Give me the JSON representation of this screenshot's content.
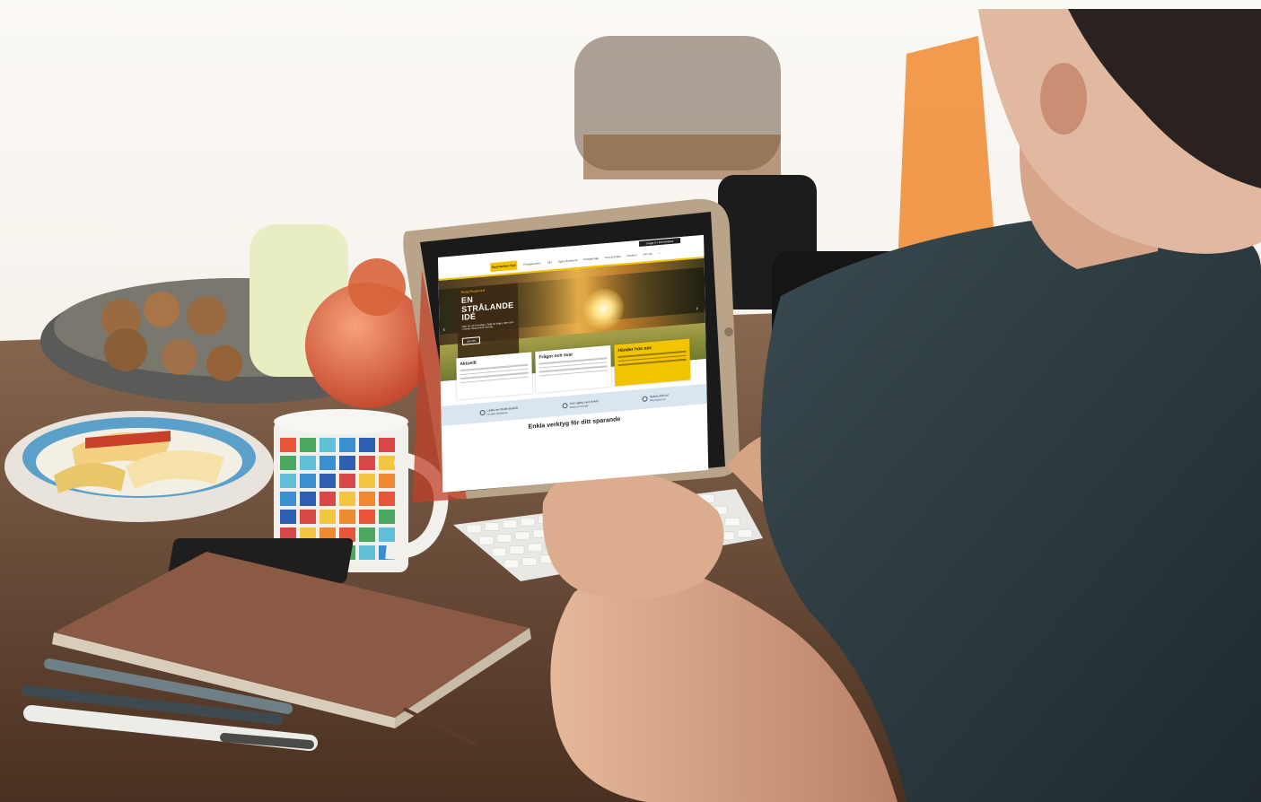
{
  "website": {
    "logo_text": "Sparbanken Syd",
    "login_button": "Logga in / Internetbank",
    "nav_items": [
      "Privatpersoner",
      "Lån",
      "Spara & placera",
      "Försäkringar",
      "Kort & betala",
      "Pension",
      "Om oss"
    ],
    "hero": {
      "kicker": "Bengt Bergstrand",
      "title_lines": [
        "EN",
        "STRÅLANDE",
        "IDÉ"
      ],
      "copy": "Idéer du vill förverkliga. Ställa du frågor, idéer som vi tänker tillsammans med dig.",
      "button": "Läs mer"
    },
    "cards": [
      {
        "title": "Aktuellt",
        "highlight": false
      },
      {
        "title": "Frågor och svar",
        "highlight": false
      },
      {
        "title": "Händer hos oss",
        "highlight": true
      }
    ],
    "strip_items": [
      {
        "label": "Ladda ner Mobilt BankID",
        "sub": "För säker identifiering"
      },
      {
        "label": "Kom igång med Swish",
        "sub": "Betala och få betalt"
      },
      {
        "label": "Spärra ditt kort",
        "sub": "Ring dygnet runt"
      }
    ],
    "tools_heading": "Enkla verktyg för ditt sparande"
  },
  "scene_colors": {
    "table": "#6b4a34",
    "shirt": "#2c3a40",
    "skin": "#d9a88a",
    "notebook": "#7a5240",
    "tablet_frame": "#b9a48a"
  }
}
